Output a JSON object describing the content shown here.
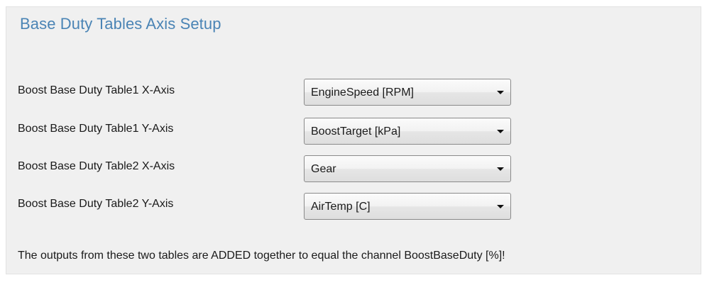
{
  "header": {
    "title": "Base Duty Tables Axis Setup"
  },
  "rows": [
    {
      "label": "Boost Base Duty Table1 X-Axis",
      "value": "EngineSpeed [RPM]"
    },
    {
      "label": "Boost Base Duty Table1 Y-Axis",
      "value": "BoostTarget [kPa]"
    },
    {
      "label": "Boost Base Duty Table2 X-Axis",
      "value": "Gear"
    },
    {
      "label": "Boost Base Duty Table2 Y-Axis",
      "value": "AirTemp [C]"
    }
  ],
  "footer": {
    "note": "The outputs from these two tables are ADDED together to equal the channel BoostBaseDuty [%]!"
  },
  "colors": {
    "title": "#4a84b5",
    "panel_background": "#f0f0f0",
    "text": "#1a1a1a"
  },
  "icons": {
    "dropdown": "chevron-down-icon"
  }
}
